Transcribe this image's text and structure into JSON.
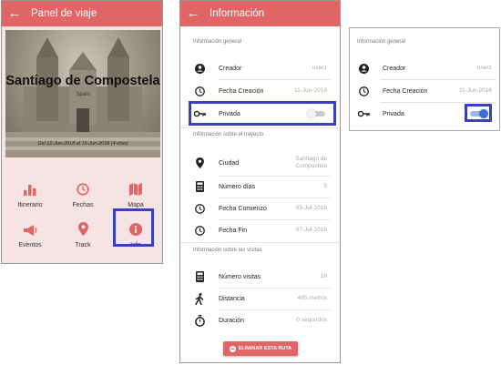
{
  "panel": {
    "title": "Panel de viaje",
    "hero": {
      "city": "Santiago de Compostela",
      "subtitle": "Spain",
      "dates": "Del 12-Jun-2018 al 15-Jun-2018 (4 días)"
    },
    "tiles": [
      {
        "label": "Itinerario",
        "icon": "bar-chart-icon"
      },
      {
        "label": "Fechas",
        "icon": "clock-icon"
      },
      {
        "label": "Mapa",
        "icon": "map-icon"
      },
      {
        "label": "Eventos",
        "icon": "megaphone-icon"
      },
      {
        "label": "Track",
        "icon": "location-pin-icon"
      },
      {
        "label": "Info",
        "icon": "info-icon"
      }
    ]
  },
  "info": {
    "title": "Información",
    "general_header": "Información general",
    "general": [
      {
        "label": "Creador",
        "value": "user1",
        "icon": "account-icon"
      },
      {
        "label": "Fecha Creación",
        "value": "11-Jun-2018",
        "icon": "clock-icon"
      },
      {
        "label": "Privada",
        "toggle": "off",
        "icon": "key-icon"
      }
    ],
    "trip_header": "Información sobre el trayecto",
    "trip": [
      {
        "label": "Ciudad",
        "value_line1": "Santiago de",
        "value_line2": "Compostela",
        "icon": "location-pin-icon"
      },
      {
        "label": "Número días",
        "value": "5",
        "icon": "calculator-icon"
      },
      {
        "label": "Fecha Comienzo",
        "value": "03-Jul-2018",
        "icon": "clock-icon"
      },
      {
        "label": "Fecha Fin",
        "value": "07-Jul-2018",
        "icon": "clock-icon"
      }
    ],
    "visits_header": "Información sobre las visitas",
    "visits": [
      {
        "label": "Número visitas",
        "value": "18",
        "icon": "calculator-icon"
      },
      {
        "label": "Distancia",
        "value": "495 metros",
        "icon": "walk-icon"
      },
      {
        "label": "Duración",
        "value": "0 segundos",
        "icon": "stopwatch-icon"
      }
    ],
    "delete_label": "ELIMINAR ESTA RUTA"
  },
  "info_crop": {
    "general_header": "Información general",
    "rows": [
      {
        "label": "Creador",
        "value": "user1"
      },
      {
        "label": "Fecha Creación",
        "value": "11-Jun-2018"
      },
      {
        "label": "Privada",
        "toggle": "on"
      }
    ]
  },
  "colors": {
    "accent": "#e06565",
    "highlight": "#3a3fc2",
    "toggle_on": "#3b6fd1"
  }
}
